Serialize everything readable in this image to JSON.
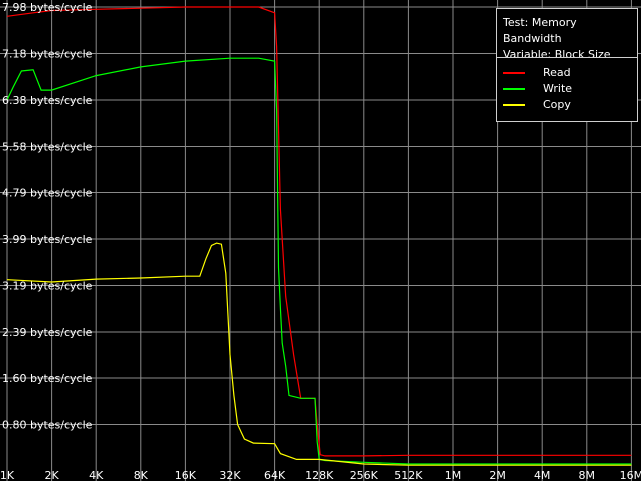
{
  "chart_data": {
    "type": "line",
    "title": "",
    "xlabel": "",
    "ylabel": "",
    "x_scale": "log2",
    "y_ticks": [
      "7.98 bytes/cycle",
      "7.18 bytes/cycle",
      "6.38 bytes/cycle",
      "5.58 bytes/cycle",
      "4.79 bytes/cycle",
      "3.99 bytes/cycle",
      "3.19 bytes/cycle",
      "2.39 bytes/cycle",
      "1.60 bytes/cycle",
      "0.80 bytes/cycle"
    ],
    "y_tick_values": [
      7.98,
      7.18,
      6.38,
      5.58,
      4.79,
      3.99,
      3.19,
      2.39,
      1.6,
      0.8
    ],
    "x_ticks": [
      "1K",
      "2K",
      "4K",
      "8K",
      "16K",
      "32K",
      "64K",
      "128K",
      "256K",
      "512K",
      "1M",
      "2M",
      "4M",
      "8M",
      "16M"
    ],
    "ylim": [
      0,
      7.98
    ],
    "grid": true,
    "legend": {
      "placement": "top-right",
      "lines": [
        "Test: Memory Bandwidth",
        "Variable: Block Size"
      ]
    },
    "series": [
      {
        "name": "Read",
        "color": "#ff0000",
        "points": [
          [
            1,
            7.82
          ],
          [
            1.5,
            7.88
          ],
          [
            2,
            7.92
          ],
          [
            4,
            7.94
          ],
          [
            8,
            7.96
          ],
          [
            16,
            7.98
          ],
          [
            32,
            7.98
          ],
          [
            50,
            7.98
          ],
          [
            64,
            7.88
          ],
          [
            66,
            7.3
          ],
          [
            70,
            4.5
          ],
          [
            76,
            3.0
          ],
          [
            86,
            2.0
          ],
          [
            96,
            1.25
          ],
          [
            104,
            1.25
          ],
          [
            120,
            1.25
          ],
          [
            124,
            0.8
          ],
          [
            130,
            0.28
          ],
          [
            140,
            0.26
          ],
          [
            256,
            0.26
          ],
          [
            512,
            0.27
          ],
          [
            1024,
            0.27
          ],
          [
            2048,
            0.27
          ],
          [
            4096,
            0.27
          ],
          [
            8192,
            0.27
          ],
          [
            16384,
            0.27
          ]
        ]
      },
      {
        "name": "Write",
        "color": "#00ff00",
        "points": [
          [
            1,
            6.38
          ],
          [
            1.1,
            6.6
          ],
          [
            1.25,
            6.88
          ],
          [
            1.5,
            6.9
          ],
          [
            1.7,
            6.55
          ],
          [
            2,
            6.55
          ],
          [
            4,
            6.8
          ],
          [
            8,
            6.95
          ],
          [
            16,
            7.05
          ],
          [
            32,
            7.1
          ],
          [
            50,
            7.1
          ],
          [
            64,
            7.05
          ],
          [
            66,
            6.2
          ],
          [
            68,
            3.5
          ],
          [
            70,
            2.8
          ],
          [
            72,
            2.2
          ],
          [
            76,
            1.8
          ],
          [
            80,
            1.3
          ],
          [
            96,
            1.25
          ],
          [
            120,
            1.25
          ],
          [
            124,
            0.5
          ],
          [
            128,
            0.2
          ],
          [
            140,
            0.18
          ],
          [
            256,
            0.15
          ],
          [
            512,
            0.12
          ],
          [
            1024,
            0.12
          ],
          [
            2048,
            0.12
          ],
          [
            4096,
            0.12
          ],
          [
            8192,
            0.12
          ],
          [
            16384,
            0.12
          ]
        ]
      },
      {
        "name": "Copy",
        "color": "#ffff00",
        "points": [
          [
            1,
            3.29
          ],
          [
            2,
            3.25
          ],
          [
            4,
            3.3
          ],
          [
            8,
            3.32
          ],
          [
            16,
            3.35
          ],
          [
            20,
            3.35
          ],
          [
            22,
            3.65
          ],
          [
            24,
            3.88
          ],
          [
            26,
            3.92
          ],
          [
            28,
            3.9
          ],
          [
            30,
            3.4
          ],
          [
            32,
            2.0
          ],
          [
            34,
            1.3
          ],
          [
            36,
            0.8
          ],
          [
            40,
            0.55
          ],
          [
            46,
            0.48
          ],
          [
            64,
            0.47
          ],
          [
            70,
            0.3
          ],
          [
            90,
            0.2
          ],
          [
            128,
            0.2
          ],
          [
            256,
            0.12
          ],
          [
            512,
            0.1
          ],
          [
            1024,
            0.1
          ],
          [
            2048,
            0.1
          ],
          [
            4096,
            0.1
          ],
          [
            8192,
            0.1
          ],
          [
            16384,
            0.1
          ]
        ]
      }
    ]
  }
}
